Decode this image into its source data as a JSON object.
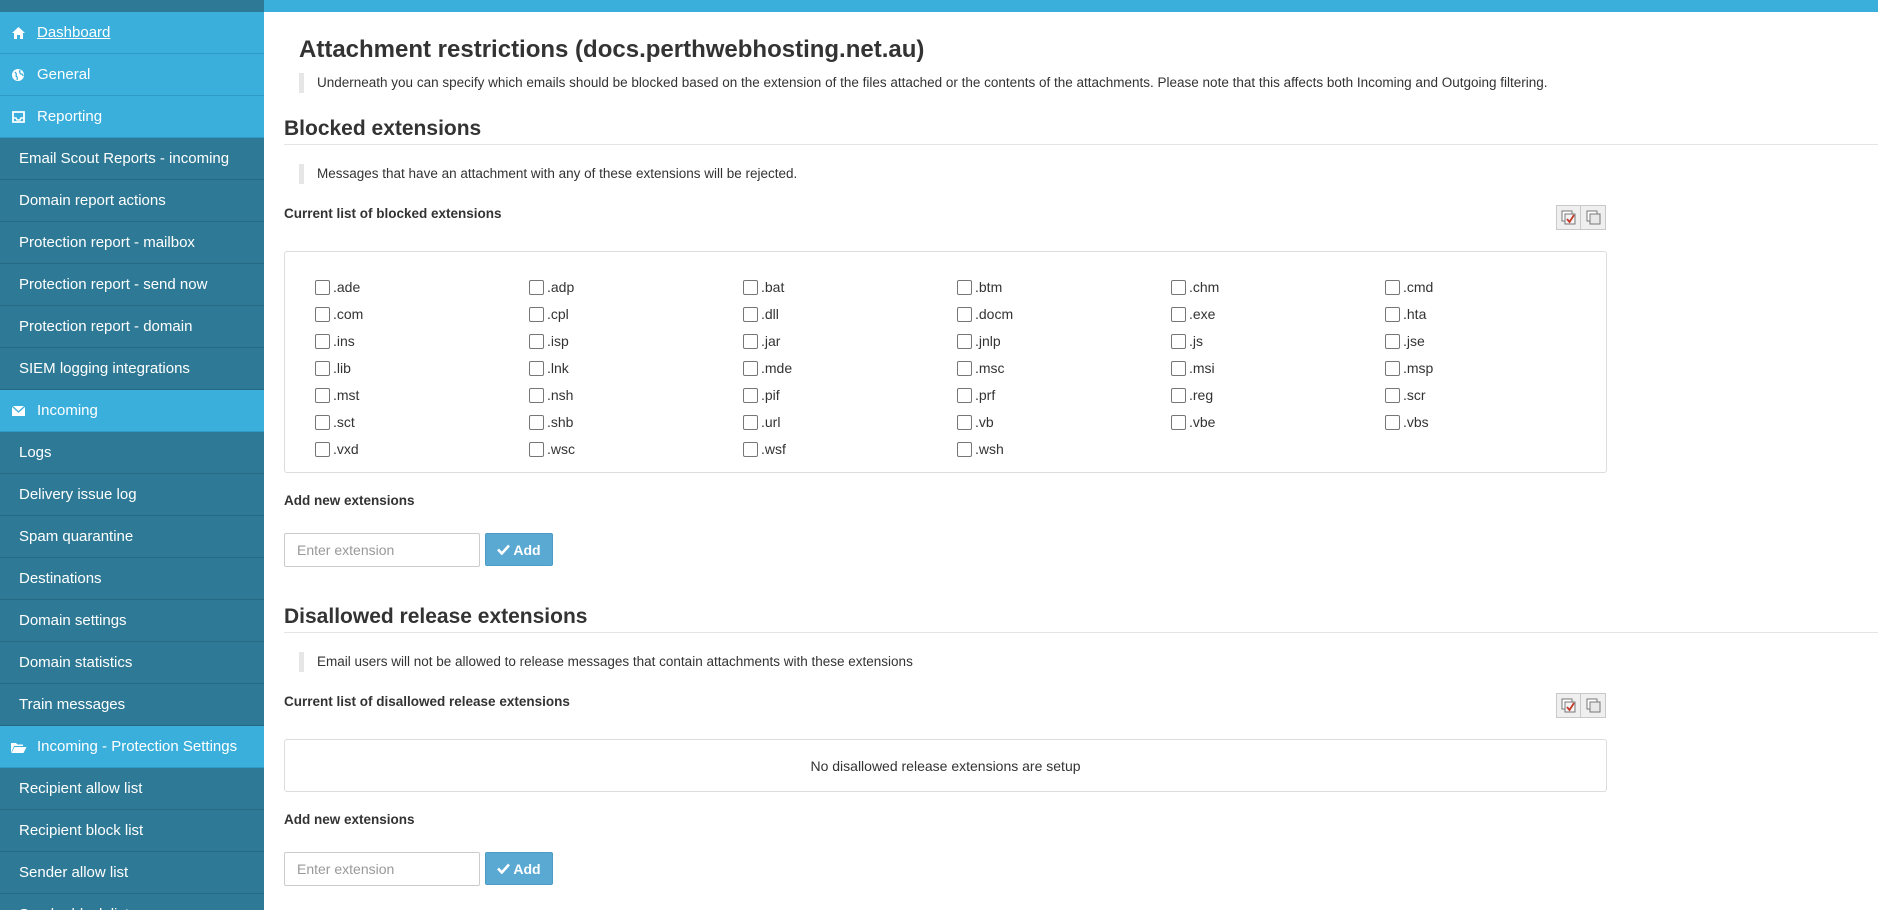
{
  "sidebar": {
    "items": [
      {
        "label": "Dashboard",
        "type": "section",
        "icon": "home-icon"
      },
      {
        "label": "General",
        "type": "section",
        "icon": "globe-icon"
      },
      {
        "label": "Reporting",
        "type": "section",
        "icon": "inbox-icon"
      },
      {
        "label": "Email Scout Reports - incoming",
        "type": "sub"
      },
      {
        "label": "Domain report actions",
        "type": "sub"
      },
      {
        "label": "Protection report - mailbox",
        "type": "sub"
      },
      {
        "label": "Protection report - send now",
        "type": "sub"
      },
      {
        "label": "Protection report - domain",
        "type": "sub"
      },
      {
        "label": "SIEM logging integrations",
        "type": "sub"
      },
      {
        "label": "Incoming",
        "type": "section",
        "icon": "envelope-icon"
      },
      {
        "label": "Logs",
        "type": "sub"
      },
      {
        "label": "Delivery issue log",
        "type": "sub"
      },
      {
        "label": "Spam quarantine",
        "type": "sub"
      },
      {
        "label": "Destinations",
        "type": "sub"
      },
      {
        "label": "Domain settings",
        "type": "sub"
      },
      {
        "label": "Domain statistics",
        "type": "sub"
      },
      {
        "label": "Train messages",
        "type": "sub"
      },
      {
        "label": "Incoming - Protection Settings",
        "type": "section",
        "icon": "folder-open-icon"
      },
      {
        "label": "Recipient allow list",
        "type": "sub"
      },
      {
        "label": "Recipient block list",
        "type": "sub"
      },
      {
        "label": "Sender allow list",
        "type": "sub"
      },
      {
        "label": "Sender block list",
        "type": "sub"
      }
    ]
  },
  "page": {
    "title": "Attachment restrictions (docs.perthwebhosting.net.au)",
    "intro": "Underneath you can specify which emails should be blocked based on the extension of the files attached or the contents of the attachments. Please note that this affects both Incoming and Outgoing filtering."
  },
  "blocked": {
    "heading": "Blocked extensions",
    "note": "Messages that have an attachment with any of these extensions will be rejected.",
    "list_label": "Current list of blocked extensions",
    "extensions": [
      ".ade",
      ".adp",
      ".bat",
      ".btm",
      ".chm",
      ".cmd",
      ".com",
      ".cpl",
      ".dll",
      ".docm",
      ".exe",
      ".hta",
      ".ins",
      ".isp",
      ".jar",
      ".jnlp",
      ".js",
      ".jse",
      ".lib",
      ".lnk",
      ".mde",
      ".msc",
      ".msi",
      ".msp",
      ".mst",
      ".nsh",
      ".pif",
      ".prf",
      ".reg",
      ".scr",
      ".sct",
      ".shb",
      ".url",
      ".vb",
      ".vbe",
      ".vbs",
      ".vxd",
      ".wsc",
      ".wsf",
      ".wsh"
    ],
    "add_label": "Add new extensions",
    "input_placeholder": "Enter extension",
    "add_button": "Add"
  },
  "disallowed": {
    "heading": "Disallowed release extensions",
    "note": "Email users will not be allowed to release messages that contain attachments with these extensions",
    "list_label": "Current list of disallowed release extensions",
    "empty_message": "No disallowed release extensions are setup",
    "add_label": "Add new extensions",
    "input_placeholder": "Enter extension",
    "add_button": "Add"
  },
  "colors": {
    "sidebar_section": "#3aafdc",
    "sidebar_sub": "#2e7a96",
    "add_button": "#5aa9d3"
  }
}
